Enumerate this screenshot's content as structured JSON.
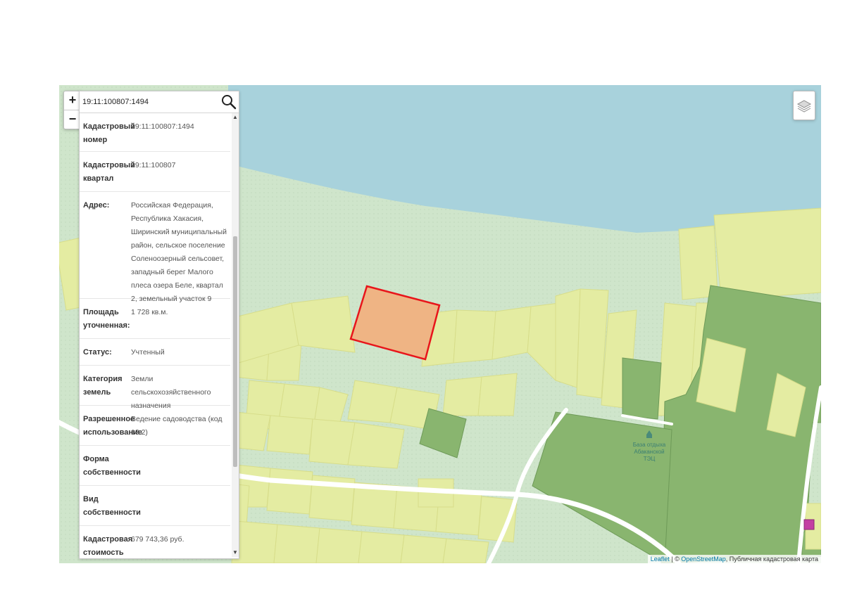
{
  "search": {
    "value": "19:11:100807:1494"
  },
  "zoom": {
    "in_label": "+",
    "out_label": "−"
  },
  "info": {
    "rows": [
      {
        "label": "Кадастровый номер",
        "value": "19:11:100807:1494"
      },
      {
        "label": "Кадастровый квартал",
        "value": "19:11:100807"
      },
      {
        "label": "Адрес:",
        "value": "Российская Федерация, Республика Хакасия, Ширинский муниципальный район, сельское поселение Соленоозерный сельсовет, западный берег Малого плеса озера Беле, квартал 2, земельный участок 9"
      },
      {
        "label": "Площадь уточненная:",
        "value": "1 728 кв.м."
      },
      {
        "label": "Статус:",
        "value": "Учтенный"
      },
      {
        "label": "Категория земель",
        "value": "Земли сельскохозяйственного назначения"
      },
      {
        "label": "Разрешенное использование",
        "value": "Ведение садоводства (код 13.2)"
      },
      {
        "label": "Форма собственности",
        "value": ""
      },
      {
        "label": "Вид собственности",
        "value": ""
      },
      {
        "label": "Кадастровая стоимость",
        "value": "679 743,36 руб."
      }
    ]
  },
  "map_label": {
    "line1": "База отдыха",
    "line2": "Абаканской",
    "line3": "ТЭЦ"
  },
  "attribution": {
    "leaflet": "Leaflet",
    "sep": " | © ",
    "osm": "OpenStreetMap",
    "rest": ", Публичная кадастровая карта"
  },
  "colors": {
    "water": "#a8d2dc",
    "land": "#cfe5cb",
    "plot_yellow": "#e4eca2",
    "plot_green": "#89b56f",
    "selected_fill": "#efb484",
    "selected_stroke": "#e8151b"
  }
}
